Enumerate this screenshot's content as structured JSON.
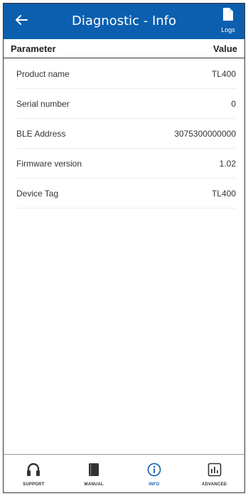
{
  "header": {
    "title": "Diagnostic - Info",
    "back_icon": "back-arrow-icon",
    "logs_label": "Logs",
    "logs_icon": "document-icon"
  },
  "table": {
    "col_parameter": "Parameter",
    "col_value": "Value",
    "rows": [
      {
        "parameter": "Product name",
        "value": "TL400"
      },
      {
        "parameter": "Serial number",
        "value": "0"
      },
      {
        "parameter": "BLE Address",
        "value": "3075300000000"
      },
      {
        "parameter": "Firmware version",
        "value": "1.02"
      },
      {
        "parameter": "Device Tag",
        "value": "TL400"
      }
    ]
  },
  "bottom_nav": {
    "items": [
      {
        "label": "SUPPORT",
        "icon": "headset-icon",
        "active": false
      },
      {
        "label": "MANUAL",
        "icon": "book-icon",
        "active": false
      },
      {
        "label": "INFO",
        "icon": "info-icon",
        "active": true
      },
      {
        "label": "ADVANCED",
        "icon": "chart-icon",
        "active": false
      }
    ]
  },
  "colors": {
    "header_bg": "#0b5fae",
    "active_nav": "#0b5fae"
  }
}
